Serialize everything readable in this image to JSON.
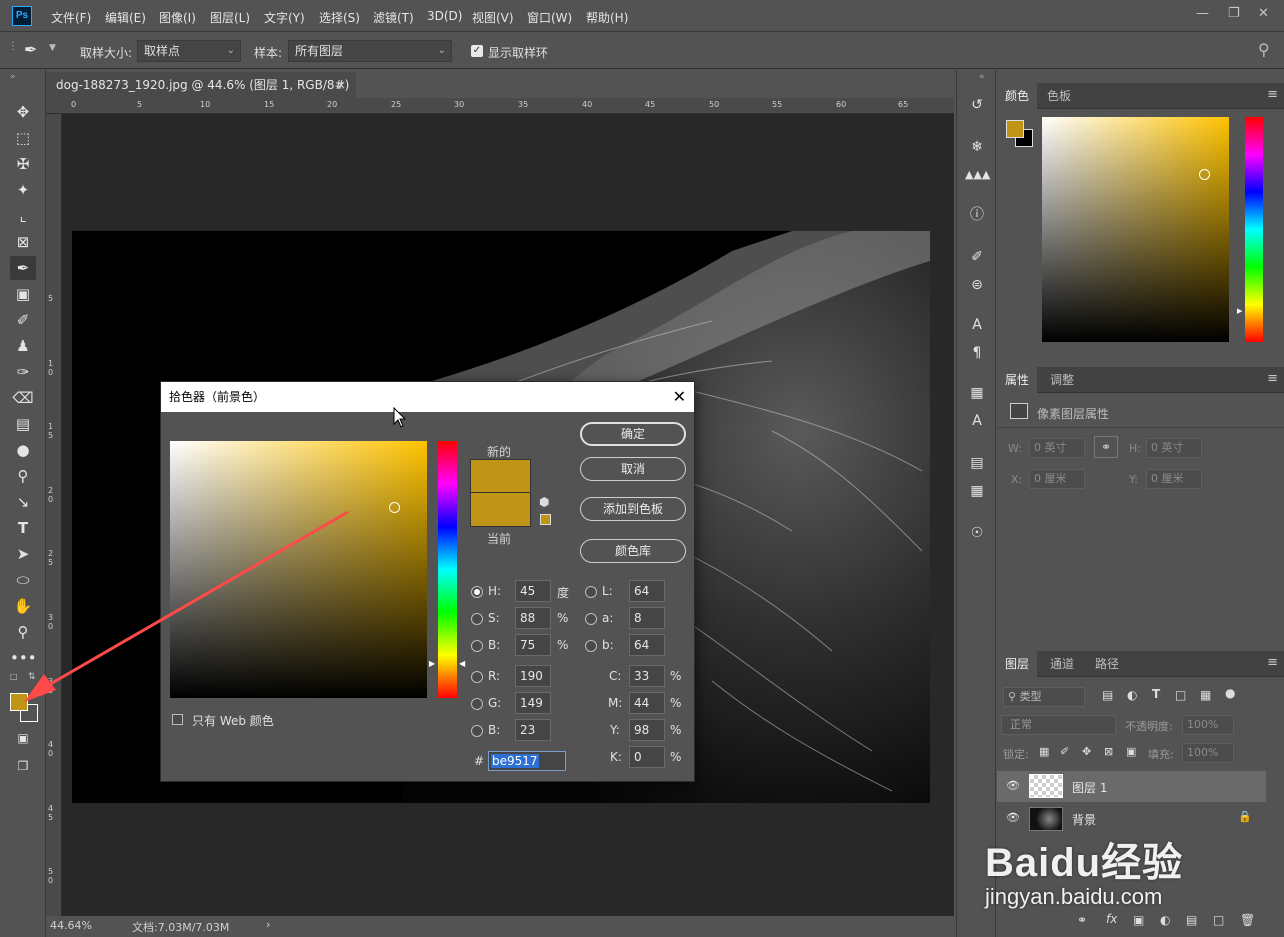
{
  "app": {
    "logo": "Ps"
  },
  "menu": [
    "文件(F)",
    "编辑(E)",
    "图像(I)",
    "图层(L)",
    "文字(Y)",
    "选择(S)",
    "滤镜(T)",
    "3D(D)",
    "视图(V)",
    "窗口(W)",
    "帮助(H)"
  ],
  "options": {
    "sample_size_label": "取样大小:",
    "sample_size_value": "取样点",
    "sample_label": "样本:",
    "sample_value": "所有图层",
    "show_ring_label": "显示取样环"
  },
  "document": {
    "tab_title": "dog-188273_1920.jpg @ 44.6% (图层 1, RGB/8#) *",
    "ruler_h": [
      "0",
      "5",
      "10",
      "15",
      "20",
      "25",
      "30",
      "35",
      "40",
      "45",
      "50",
      "55",
      "60",
      "65"
    ],
    "ruler_v": [
      "5",
      "1 0",
      "1 5",
      "2 0",
      "2 5",
      "3 0",
      "3 5",
      "4 0",
      "4 5",
      "5 0"
    ]
  },
  "status": {
    "zoom": "44.64%",
    "doc": "文档:7.03M/7.03M",
    "arrow": "›"
  },
  "dialog": {
    "title": "拾色器（前景色）",
    "new_label": "新的",
    "current_label": "当前",
    "new_color": "#be9517",
    "current_color": "#be9517",
    "ok": "确定",
    "cancel": "取消",
    "add_swatch": "添加到色板",
    "color_library": "颜色库",
    "web_only_label": "只有 Web 颜色",
    "hsb": {
      "h_label": "H:",
      "h": "45",
      "h_unit": "度",
      "s_label": "S:",
      "s": "88",
      "s_unit": "%",
      "b_label": "B:",
      "b": "75",
      "b_unit": "%"
    },
    "lab": {
      "l_label": "L:",
      "l": "64",
      "a_label": "a:",
      "a": "8",
      "b_label": "b:",
      "b": "64"
    },
    "rgb": {
      "r_label": "R:",
      "r": "190",
      "g_label": "G:",
      "g": "149",
      "b_label": "B:",
      "b": "23"
    },
    "cmyk": {
      "c_label": "C:",
      "c": "33",
      "m_label": "M:",
      "m": "44",
      "y_label": "Y:",
      "y": "98",
      "k_label": "K:",
      "k": "0",
      "unit": "%"
    },
    "hex_label": "#",
    "hex": "be9517"
  },
  "color_panel": {
    "tabs": [
      "颜色",
      "色板"
    ],
    "fg": "#be9517",
    "bg": "#000000"
  },
  "props_panel": {
    "tabs": [
      "属性",
      "调整"
    ],
    "title": "像素图层属性",
    "w_label": "W:",
    "w": "0 英寸",
    "h_label": "H:",
    "h": "0 英寸",
    "x_label": "X:",
    "x": "0 厘米",
    "y_label": "Y:",
    "y": "0 厘米"
  },
  "layers_panel": {
    "tabs": [
      "图层",
      "通道",
      "路径"
    ],
    "filter": "类型",
    "blend": "正常",
    "opacity_label": "不透明度:",
    "opacity": "100%",
    "lock_label": "锁定:",
    "fill_label": "填充:",
    "fill": "100%",
    "layers": [
      {
        "name": "图层 1",
        "selected": true
      },
      {
        "name": "背景",
        "selected": false
      }
    ]
  },
  "watermark": {
    "brand": "Baidu经验",
    "url": "jingyan.baidu.com"
  }
}
